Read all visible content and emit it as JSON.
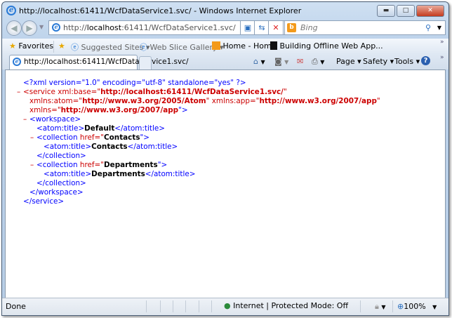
{
  "window": {
    "title": "http://localhost:61411/WcfDataService1.svc/ - Windows Internet Explorer",
    "minimize": "▬",
    "maximize": "□",
    "close": "✕"
  },
  "nav": {
    "back": "◀",
    "forward": "▶",
    "address_prefix": "http://",
    "address_host": "localhost",
    "address_rest": ":61411/WcfDataService1.svc/",
    "search_placeholder": "Bing",
    "search_logo": "b"
  },
  "favorites": {
    "label": "Favorites",
    "items": [
      {
        "label": "Suggested Sites ▾"
      },
      {
        "label": "Web Slice Gallery ▾"
      },
      {
        "label": "Home - Home"
      },
      {
        "label": "Building Offline Web App..."
      }
    ]
  },
  "tab": {
    "label": "http://localhost:61411/WcfDataService1.svc/"
  },
  "commands": {
    "page": "Page ▾",
    "safety": "Safety ▾",
    "tools": "Tools ▾",
    "help": "?"
  },
  "xml": [
    {
      "indent": 25,
      "minus": false,
      "segs": [
        [
          "t",
          "<?xml version=\"1.0\" encoding=\"utf-8\" standalone=\"yes\" ?>"
        ]
      ]
    },
    {
      "indent": 25,
      "minus": true,
      "segs": [
        [
          "a",
          "<service xml:base=\""
        ],
        [
          "v",
          "http://localhost:61411/WcfDataService1.svc/"
        ],
        [
          "a",
          "\""
        ]
      ]
    },
    {
      "indent": 34,
      "minus": false,
      "segs": [
        [
          "a",
          "xmlns:atom=\""
        ],
        [
          "v",
          "http://www.w3.org/2005/Atom"
        ],
        [
          "a",
          "\" xmlns:app=\""
        ],
        [
          "v",
          "http://www.w3.org/2007/app"
        ],
        [
          "a",
          "\""
        ]
      ]
    },
    {
      "indent": 34,
      "minus": false,
      "segs": [
        [
          "a",
          "xmlns=\""
        ],
        [
          "v",
          "http://www.w3.org/2007/app"
        ],
        [
          "t",
          "\">"
        ]
      ]
    },
    {
      "indent": 34,
      "minus": true,
      "segs": [
        [
          "t",
          "<workspace>"
        ]
      ]
    },
    {
      "indent": 44,
      "minus": false,
      "segs": [
        [
          "t",
          "<atom:title>"
        ],
        [
          "x",
          "Default"
        ],
        [
          "t",
          "</atom:title>"
        ]
      ]
    },
    {
      "indent": 44,
      "minus": true,
      "segs": [
        [
          "t",
          "<collection "
        ],
        [
          "a",
          "href=\""
        ],
        [
          "x",
          "Contacts"
        ],
        [
          "t",
          "\">"
        ]
      ]
    },
    {
      "indent": 54,
      "minus": false,
      "segs": [
        [
          "t",
          "<atom:title>"
        ],
        [
          "x",
          "Contacts"
        ],
        [
          "t",
          "</atom:title>"
        ]
      ]
    },
    {
      "indent": 44,
      "minus": false,
      "segs": [
        [
          "t",
          "</collection>"
        ]
      ]
    },
    {
      "indent": 44,
      "minus": true,
      "segs": [
        [
          "t",
          "<collection "
        ],
        [
          "a",
          "href=\""
        ],
        [
          "x",
          "Departments"
        ],
        [
          "t",
          "\">"
        ]
      ]
    },
    {
      "indent": 54,
      "minus": false,
      "segs": [
        [
          "t",
          "<atom:title>"
        ],
        [
          "x",
          "Departments"
        ],
        [
          "t",
          "</atom:title>"
        ]
      ]
    },
    {
      "indent": 44,
      "minus": false,
      "segs": [
        [
          "t",
          "</collection>"
        ]
      ]
    },
    {
      "indent": 34,
      "minus": false,
      "segs": [
        [
          "t",
          "</workspace>"
        ]
      ]
    },
    {
      "indent": 25,
      "minus": false,
      "segs": [
        [
          "t",
          "</service>"
        ]
      ]
    }
  ],
  "minus_glyph": "–",
  "status": {
    "text": "Done",
    "zone": "Internet | Protected Mode: Off",
    "zoom": "100%"
  }
}
